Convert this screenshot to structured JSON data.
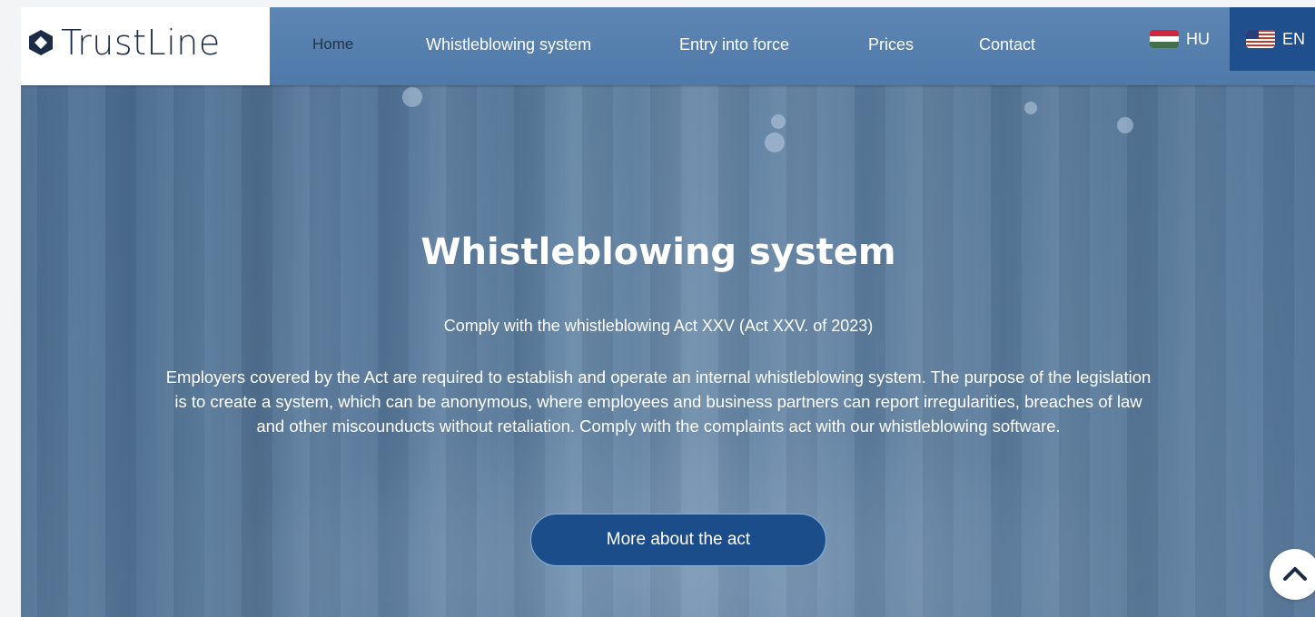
{
  "brand": {
    "name": "TrustLine",
    "logo_icon": "hexagon-diamond-icon"
  },
  "nav": {
    "items": [
      {
        "label": "Home",
        "active": true
      },
      {
        "label": "Whistleblowing system",
        "active": false
      },
      {
        "label": "Entry into force",
        "active": false
      },
      {
        "label": "Prices",
        "active": false
      },
      {
        "label": "Contact",
        "active": false
      }
    ]
  },
  "languages": [
    {
      "code": "HU",
      "flag": "hungary-flag-icon",
      "active": false
    },
    {
      "code": "EN",
      "flag": "usa-flag-icon",
      "active": true
    }
  ],
  "hero": {
    "title": "Whistleblowing system",
    "subtitle": "Comply with the whistleblowing Act XXV (Act XXV. of 2023)",
    "body": "Employers covered by the Act are required to establish and operate an internal whistleblowing system. The purpose of the legislation is to create a system, which can be anonymous, where employees and business partners can report irregularities, breaches of law and other miscounducts without retaliation. Comply with the complaints act with our whistleblowing software.",
    "cta_label": "More about the act"
  },
  "scroll_top": {
    "icon": "chevron-up-icon"
  },
  "colors": {
    "header": "#5580b0",
    "active_lang_bg": "#1f4f8c",
    "cta_bg": "#1b4d8a",
    "brand_text": "#1b2b45"
  }
}
